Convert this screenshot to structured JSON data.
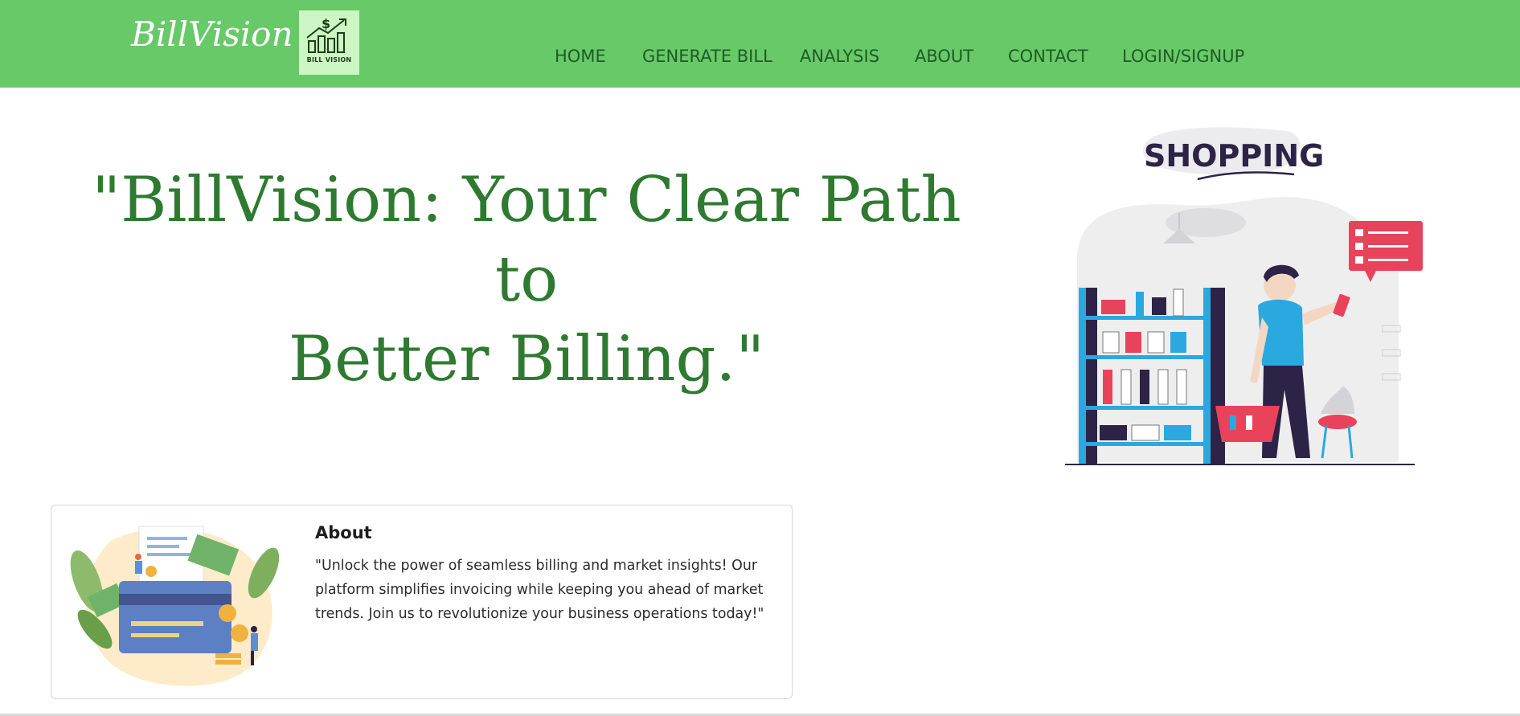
{
  "brand": {
    "name": "BillVision",
    "logo_text": "BILL VISION"
  },
  "nav": {
    "items": [
      {
        "label": "HOME"
      },
      {
        "label": "GENERATE BILL"
      },
      {
        "label": "ANALYSIS"
      },
      {
        "label": "ABOUT"
      },
      {
        "label": "CONTACT"
      },
      {
        "label": "LOGIN/SIGNUP"
      }
    ]
  },
  "hero": {
    "line1": "\"BillVision: Your Clear Path to",
    "line2": "Better Billing.\"",
    "illustration_title": "SHOPPING"
  },
  "about": {
    "title": "About",
    "text": "\"Unlock the power of seamless billing and market insights! Our platform simplifies invoicing while keeping you ahead of market trends. Join us to revolutionize your business operations today!\""
  },
  "colors": {
    "navbar": "#68c969",
    "nav_text": "#1f5b22",
    "hero_text": "#2e7a30",
    "logo_bg": "#ccf7c4"
  }
}
